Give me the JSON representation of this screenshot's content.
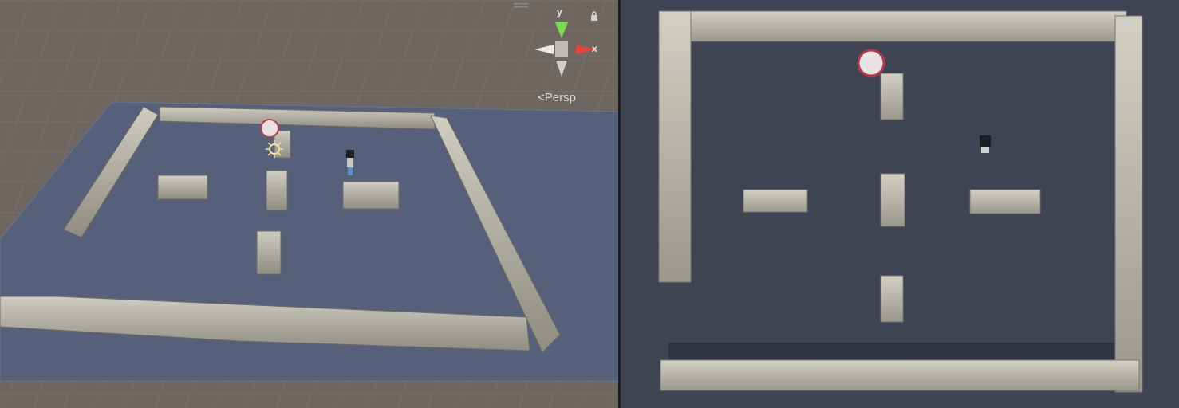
{
  "scene_view": {
    "gizmo": {
      "y_label": "y",
      "x_label": "x",
      "projection_label": "Persp"
    },
    "colors": {
      "sky": "#6e6761",
      "floor": "#56607a",
      "wall": "#b9b6aa",
      "gizmo_y": "#7ed957",
      "gizmo_x": "#e0463a"
    }
  },
  "game_view": {
    "colors": {
      "floor": "#3f4352",
      "wall": "#c0bcae"
    }
  }
}
